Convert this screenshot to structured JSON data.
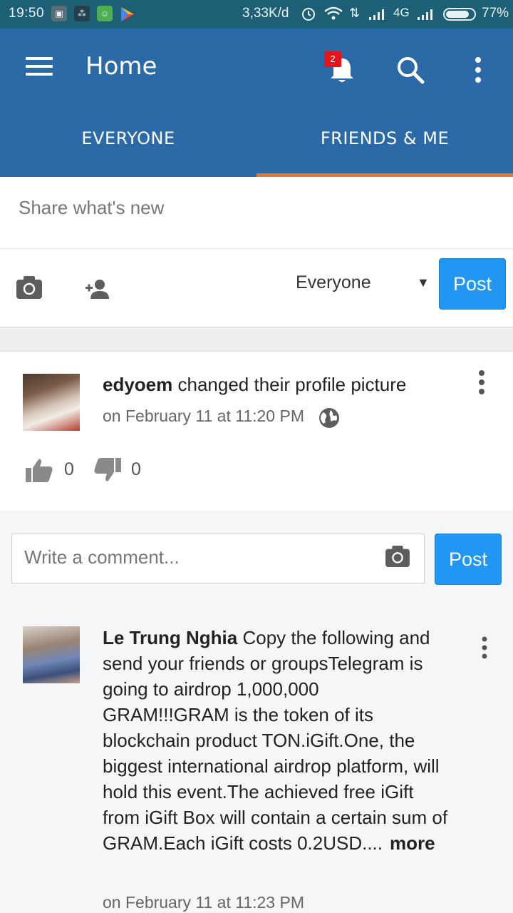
{
  "status_bar": {
    "time": "19:50",
    "speed": "3,33K/d",
    "network": "4G",
    "battery": "77%"
  },
  "app_bar": {
    "title": "Home",
    "notification_count": "2",
    "tabs": [
      {
        "label": "EVERYONE",
        "active": false
      },
      {
        "label": "FRIENDS & ME",
        "active": true
      }
    ],
    "tab_indicator_color": "#e8782a",
    "bar_color": "#2b6aa6"
  },
  "composer": {
    "placeholder": "Share what's new",
    "audience": "Everyone",
    "post_label": "Post"
  },
  "feed": [
    {
      "author": "edyoem",
      "action": " changed their profile picture",
      "time": "on February 11 at 11:20 PM",
      "likes": "0",
      "dislikes": "0"
    },
    {
      "author": "Le Trung Nghia",
      "body": " Copy the following and send your friends or groupsTelegram is going to airdrop 1,000,000 GRAM!!!GRAM is the token of its blockchain product TON.iGift.One, the biggest international airdrop platform, will hold this event.The achieved free iGift from iGift Box will contain a certain sum of GRAM.Each iGift costs 0.2USD....",
      "more_label": "more",
      "time": "on February 11 at 11:23 PM"
    }
  ],
  "comment": {
    "placeholder": "Write a comment...",
    "post_label": "Post"
  },
  "colors": {
    "post_button": "#2196f3",
    "status_bar": "#1d5f75"
  }
}
